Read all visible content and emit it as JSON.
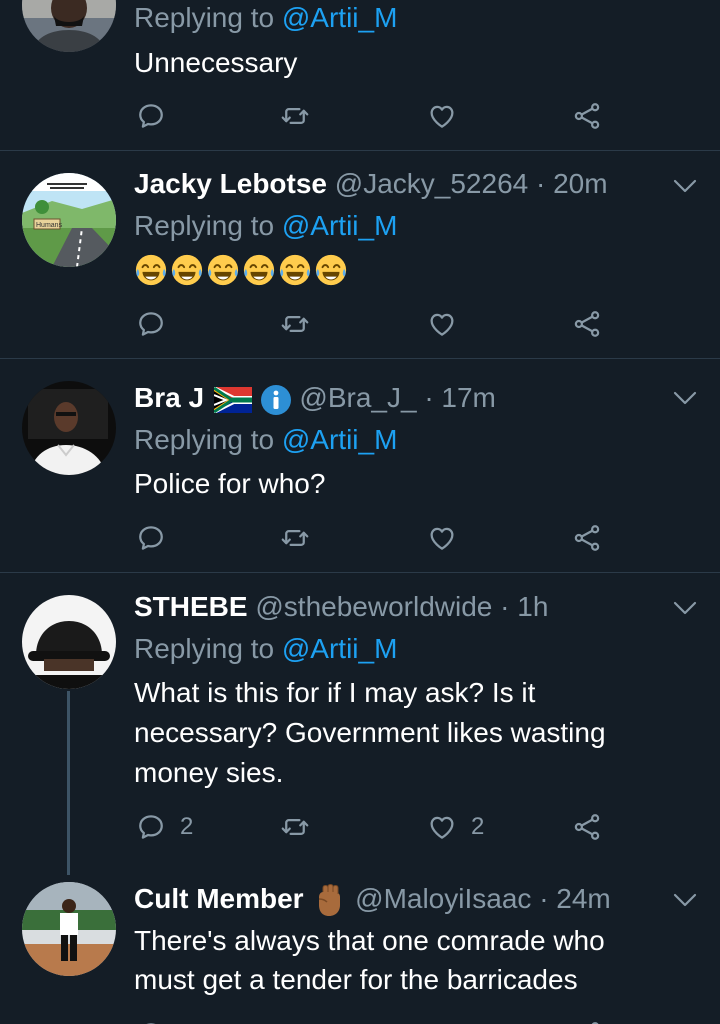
{
  "tweets": [
    {
      "replying_label": "Replying to",
      "replying_to": "@Artii_M",
      "text": "Unnecessary",
      "reply_count": "",
      "like_count": ""
    },
    {
      "name": "Jacky Lebotse",
      "handle": "@Jacky_52264",
      "time": "· 20m",
      "replying_label": "Replying to",
      "replying_to": "@Artii_M",
      "emoji_text": "😂😂😂😂😂😂",
      "avatar_text": "Humans"
    },
    {
      "name": "Bra J",
      "handle": "@Bra_J_",
      "time": "· 17m",
      "replying_label": "Replying to",
      "replying_to": "@Artii_M",
      "text": "Police for who?"
    },
    {
      "name": "STHEBE",
      "handle": "@sthebeworldwide",
      "time": "· 1h",
      "replying_label": "Replying to",
      "replying_to": "@Artii_M",
      "text_lines": [
        "What is this for if I may ask? Is it",
        "necessary? Government likes wasting",
        "money sies."
      ],
      "reply_count": "2",
      "like_count": "2"
    },
    {
      "name": "Cult Member",
      "handle": "@MaloyiIsaac",
      "time": "· 24m",
      "text_lines": [
        "There's always that one comrade who",
        "must get a tender for the barricades"
      ]
    }
  ],
  "icons": [
    "reply-icon",
    "retweet-icon",
    "like-icon",
    "share-icon",
    "chevron-down-icon",
    "south-africa-flag-icon",
    "info-icon",
    "raised-fist-icon"
  ],
  "colors": {
    "background": "#141d26",
    "mention": "#1da1f2",
    "secondary": "#8899a6",
    "divider": "#2b3a48"
  }
}
